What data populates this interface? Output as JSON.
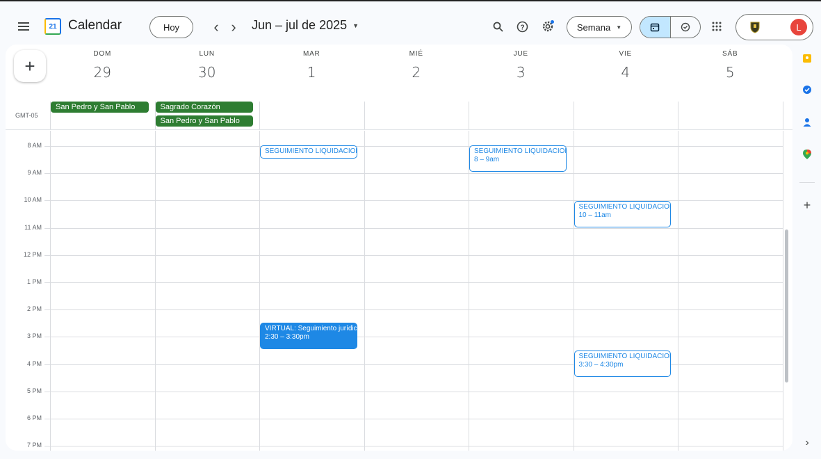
{
  "header": {
    "menu_icon": "menu-icon",
    "logo_day": "21",
    "app_title": "Calendar",
    "today_label": "Hoy",
    "prev_glyph": "‹",
    "next_glyph": "›",
    "date_range": "Jun – jul de 2025",
    "view_selector": "Semana",
    "avatar_initial": "L"
  },
  "timezone": "GMT-05",
  "days": [
    {
      "name": "DOM",
      "number": "29"
    },
    {
      "name": "LUN",
      "number": "30"
    },
    {
      "name": "MAR",
      "number": "1"
    },
    {
      "name": "MIÉ",
      "number": "2"
    },
    {
      "name": "JUE",
      "number": "3"
    },
    {
      "name": "VIE",
      "number": "4"
    },
    {
      "name": "SÁB",
      "number": "5"
    }
  ],
  "all_day_events": [
    {
      "title": "San Pedro y San Pablo",
      "day": 0
    },
    {
      "title": "Sagrado Corazón",
      "day": 1
    },
    {
      "title": "San Pedro y San Pablo",
      "day": 1
    }
  ],
  "hours": [
    "8 AM",
    "9 AM",
    "10 AM",
    "11 AM",
    "12 PM",
    "1 PM",
    "2 PM",
    "3 PM",
    "4 PM",
    "5 PM",
    "6 PM",
    "7 PM"
  ],
  "events": [
    {
      "title": "SEGUIMIENTO LIQUIDACION",
      "time": "",
      "day": 2,
      "style": "outline"
    },
    {
      "title": "SEGUIMIENTO LIQUIDACION",
      "time": "8 – 9am",
      "day": 4,
      "style": "outline"
    },
    {
      "title": "SEGUIMIENTO LIQUIDACION",
      "time": "10 – 11am",
      "day": 5,
      "style": "outline"
    },
    {
      "title": "VIRTUAL: Seguimiento jurídico",
      "time": "2:30 – 3:30pm",
      "day": 2,
      "style": "filled"
    },
    {
      "title": "SEGUIMIENTO LIQUIDACION",
      "time": "3:30 – 4:30pm",
      "day": 5,
      "style": "outline"
    }
  ],
  "colors": {
    "event_blue": "#1e88e5",
    "holiday_green": "#2e7d32",
    "avatar": "#e8453c"
  }
}
